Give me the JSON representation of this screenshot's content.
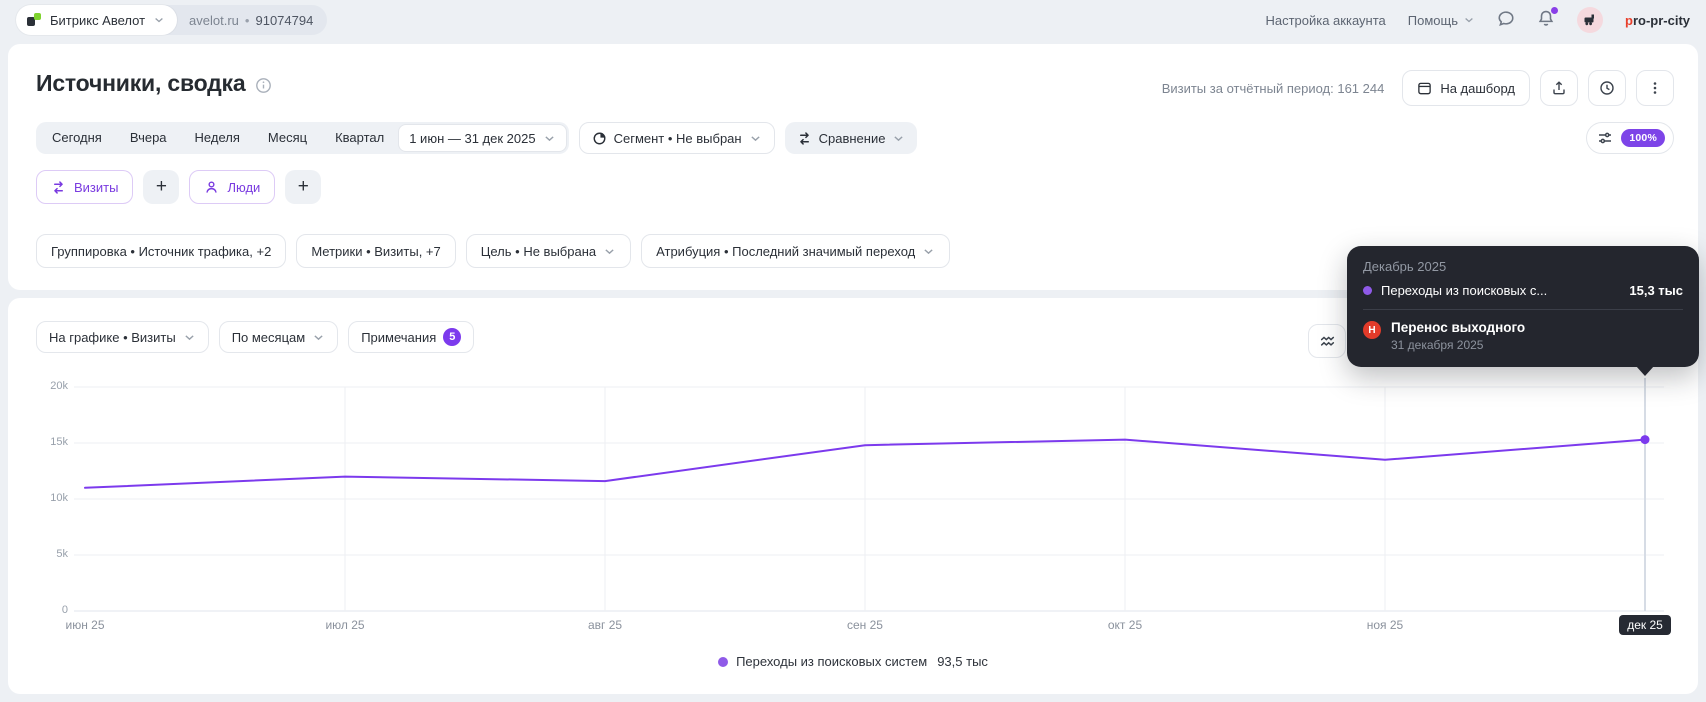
{
  "topbar": {
    "counter_name": "Битрикс Авелот",
    "site": "avelot.ru",
    "separator": "•",
    "counter_id": "91074794",
    "account_settings": "Настройка аккаунта",
    "help": "Помощь",
    "user_prefix": "p",
    "user_suffix": "ro-pr-city"
  },
  "header": {
    "title": "Источники, сводка",
    "visits_period": "Визиты за отчётный период: 161 244",
    "dashboard_button": "На дашборд"
  },
  "period": {
    "tabs": [
      "Сегодня",
      "Вчера",
      "Неделя",
      "Месяц",
      "Квартал"
    ],
    "date_range": "1 июн — 31 дек 2025",
    "segment": "Сегмент • Не выбран",
    "comparison": "Сравнение",
    "sampling": "100%"
  },
  "metrics": {
    "visits": "Визиты",
    "people": "Люди",
    "add": "+"
  },
  "filters": [
    {
      "label": "Группировка • Источник трафика, +2",
      "chevron": false
    },
    {
      "label": "Метрики • Визиты, +7",
      "chevron": false
    },
    {
      "label": "Цель • Не выбрана",
      "chevron": true
    },
    {
      "label": "Атрибуция • Последний значимый переход",
      "chevron": true
    }
  ],
  "chart_controls": {
    "metric_select": "На графике • Визиты",
    "grouping_select": "По месяцам",
    "notes": "Примечания",
    "notes_count": "5"
  },
  "tooltip": {
    "title": "Декабрь 2025",
    "series_label": "Переходы из поисковых с...",
    "series_value": "15,3 тыс",
    "note_badge": "Н",
    "note_title": "Перенос выходного",
    "note_date": "31 декабря 2025"
  },
  "legend": {
    "label": "Переходы из поисковых систем",
    "value": "93,5 тыс"
  },
  "chart_data": {
    "type": "line",
    "title": "",
    "x": [
      "июн 25",
      "июл 25",
      "авг 25",
      "сен 25",
      "окт 25",
      "ноя 25",
      "дек 25"
    ],
    "series": [
      {
        "name": "Переходы из поисковых систем",
        "values": [
          11000,
          12000,
          11600,
          14800,
          15300,
          13500,
          15300
        ]
      }
    ],
    "ylim": [
      0,
      20000
    ],
    "yticks": [
      20000,
      15000,
      10000,
      5000,
      0
    ],
    "ytick_labels": [
      "20k",
      "15k",
      "10k",
      "5k",
      "0"
    ],
    "xlabel": "",
    "ylabel": "",
    "grid": true,
    "legend_position": "bottom",
    "line_color": "#7c3aed",
    "highlight_index": 6
  },
  "colors": {
    "accent": "#7c3aed",
    "sampling_badge": "#7d44e8",
    "note_red": "#e23b2a",
    "tooltip_bg": "#24262e",
    "page_bg": "#edf0f4"
  }
}
